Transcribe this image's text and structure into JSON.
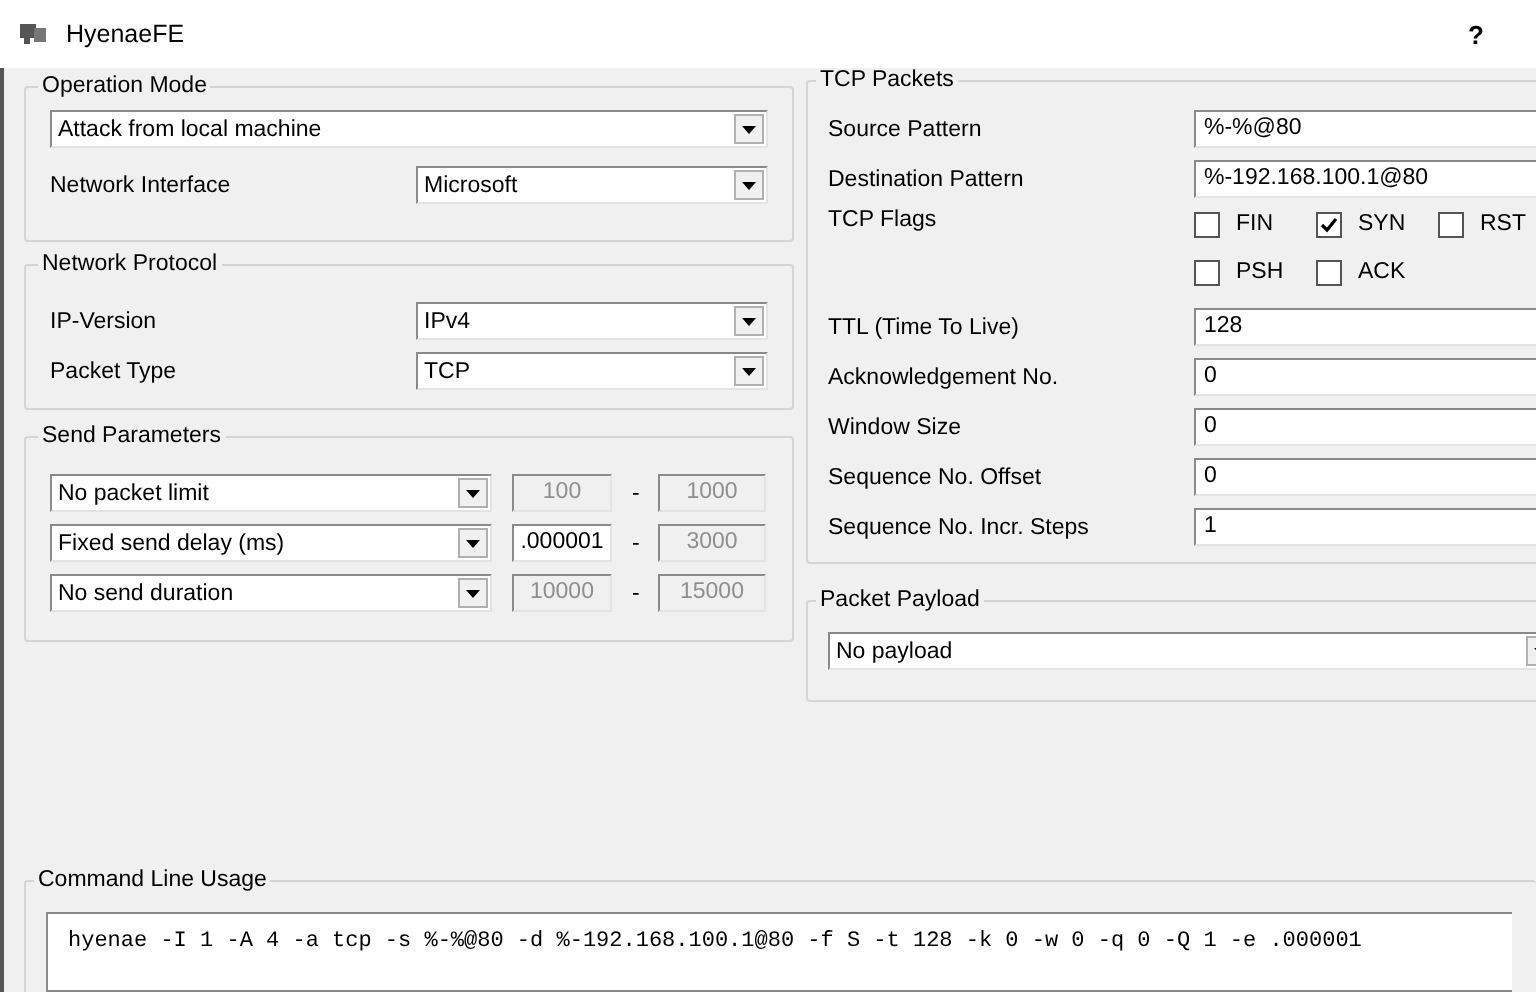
{
  "window": {
    "title": "HyenaeFE",
    "help": "?"
  },
  "operation_mode": {
    "title": "Operation Mode",
    "mode": "Attack from local machine",
    "network_interface": {
      "label": "Network Interface",
      "value": "Microsoft"
    }
  },
  "network_protocol": {
    "title": "Network Protocol",
    "fields": [
      {
        "label": "IP-Version",
        "value": "IPv4"
      },
      {
        "label": "Packet Type",
        "value": "TCP"
      }
    ]
  },
  "send_parameters": {
    "title": "Send Parameters",
    "rows": [
      {
        "mode": "No packet limit",
        "min": {
          "value": "100",
          "disabled": true
        },
        "max": {
          "value": "1000",
          "disabled": true
        }
      },
      {
        "mode": "Fixed send delay (ms)",
        "min": {
          "value": ".000001",
          "disabled": false
        },
        "max": {
          "value": "3000",
          "disabled": true
        }
      },
      {
        "mode": "No send duration",
        "min": {
          "value": "10000",
          "disabled": true
        },
        "max": {
          "value": "15000",
          "disabled": true
        }
      }
    ],
    "separator": "-"
  },
  "tcp_packets": {
    "title": "TCP Packets",
    "fields_before": [
      {
        "label": "Source Pattern",
        "value": "%-%@80"
      },
      {
        "label": "Destination Pattern",
        "value": "%-192.168.100.1@80"
      }
    ],
    "flags_label": "TCP Flags",
    "flags": [
      {
        "label": "FIN",
        "checked": false
      },
      {
        "label": "SYN",
        "checked": true
      },
      {
        "label": "RST",
        "checked": false
      },
      {
        "label": "PSH",
        "checked": false
      },
      {
        "label": "ACK",
        "checked": false
      }
    ],
    "fields_after": [
      {
        "label": "TTL (Time To Live)",
        "value": "128"
      },
      {
        "label": "Acknowledgement No.",
        "value": "0"
      },
      {
        "label": "Window Size",
        "value": "0"
      },
      {
        "label": "Sequence No. Offset",
        "value": "0"
      },
      {
        "label": "Sequence No. Incr. Steps",
        "value": "1"
      }
    ]
  },
  "packet_payload": {
    "title": "Packet Payload",
    "value": "No payload"
  },
  "command_line": {
    "title": "Command Line Usage",
    "value": "hyenae -I 1 -A 4 -a tcp -s %-%@80 -d %-192.168.100.1@80 -f S -t 128 -k 0 -w 0 -q 0 -Q 1 -e .000001"
  }
}
